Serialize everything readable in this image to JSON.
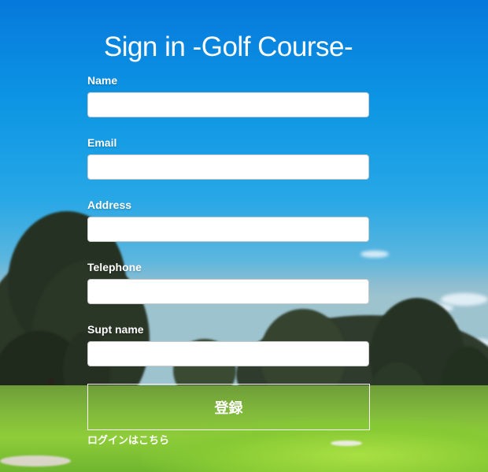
{
  "title": "Sign in -Golf Course-",
  "fields": [
    {
      "label": "Name",
      "value": "",
      "placeholder": ""
    },
    {
      "label": "Email",
      "value": "",
      "placeholder": ""
    },
    {
      "label": "Address",
      "value": "",
      "placeholder": ""
    },
    {
      "label": "Telephone",
      "value": "",
      "placeholder": ""
    },
    {
      "label": "Supt name",
      "value": "",
      "placeholder": ""
    }
  ],
  "submit_label": "登録",
  "login_link_label": "ログインはこちら"
}
